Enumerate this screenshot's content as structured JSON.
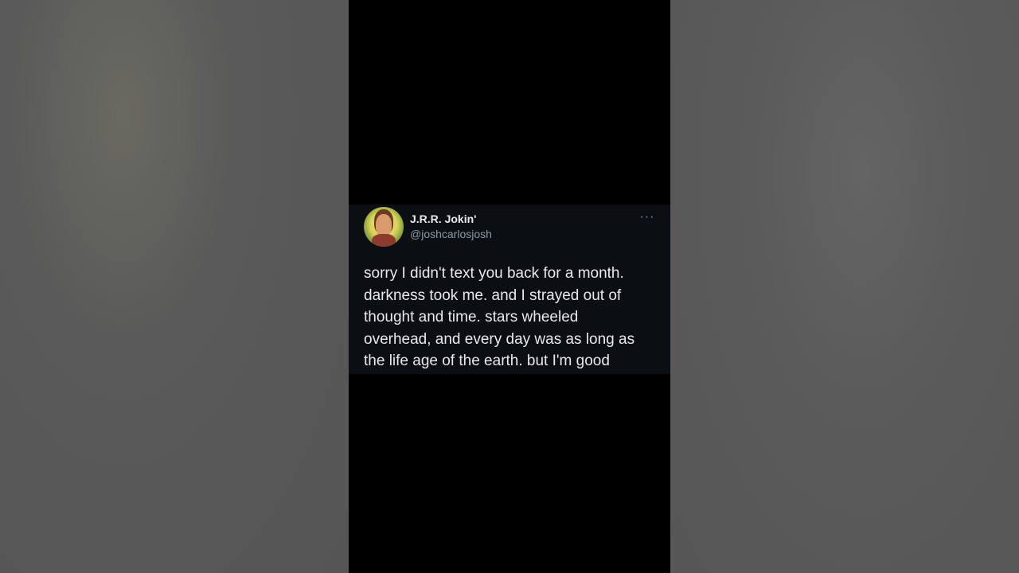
{
  "tweet": {
    "display_name": "J.R.R. Jokin'",
    "handle": "@joshcarlosjosh",
    "more_icon": "more-horizontal-icon",
    "text_lines": [
      "sorry I didn't text you back for a month.",
      "darkness took me. and I strayed out of",
      "thought and time. stars wheeled",
      "overhead, and every day was as long as",
      "the life age of the earth. but I'm good"
    ]
  },
  "colors": {
    "phone_background": "#000000",
    "tweet_background": "#0b0e12",
    "text_primary": "#e7e9ea",
    "text_secondary": "#8b98a5",
    "side_blur": "#5a5a5a"
  }
}
